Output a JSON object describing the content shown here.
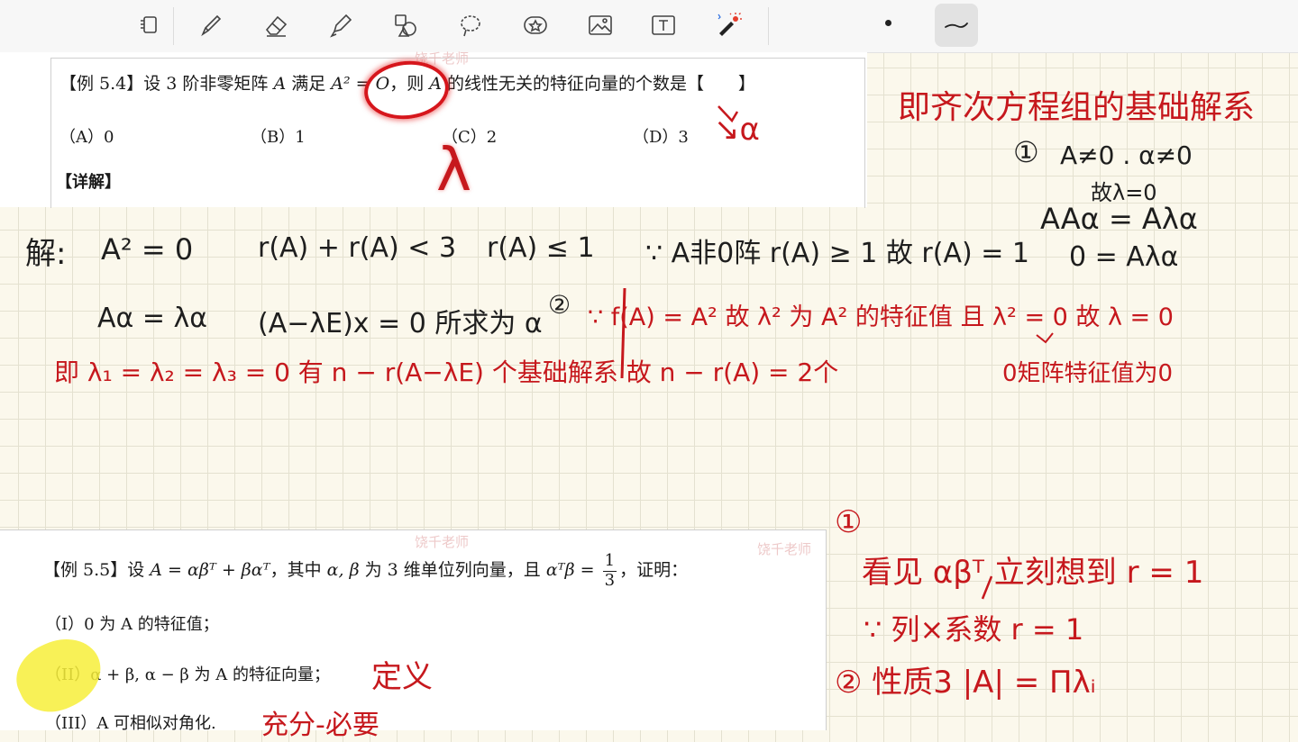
{
  "toolbar": {
    "tools": [
      "lasso-select-icon",
      "pen-icon",
      "eraser-icon",
      "highlighter-icon",
      "shapes-icon",
      "lasso-icon",
      "sticker-icon",
      "image-icon",
      "text-box-icon",
      "laser-pointer-icon"
    ],
    "pen_color": "#222222"
  },
  "example_54": {
    "title": "【例 5.4】设 3 阶非零矩阵 A 满足 A² = O，则 A 的线性无关的特征向量的个数是【　　】",
    "t_prefix": "【例 5.4】设 3 阶非零矩阵 ",
    "t_a": "A",
    "t_mid": " 满足 ",
    "t_eq": "A² = O",
    "t_mid2": "，则 ",
    "t_a2": "A",
    "t_suffix": " 的线性无关的特征向量的个数是【　　】",
    "options": [
      "（A）0",
      "（B）1",
      "（C）2",
      "（D）3"
    ],
    "detail_label": "【详解】"
  },
  "example_55": {
    "t_prefix": "【例 5.5】设 ",
    "t_formula": "A = αβᵀ + βαᵀ",
    "t_mid": "，其中 ",
    "t_vecs": "α, β",
    "t_mid2": " 为 3 维单位列向量，且 ",
    "t_cond": "αᵀβ = ",
    "frac_num": "1",
    "frac_den": "3",
    "t_suffix": "，证明：",
    "part1": "（I）0 为 A 的特征值；",
    "part2": "（II）α + β, α − β 为 A 的特征向量；",
    "part3": "（III）A 可相似对角化."
  },
  "watermark": "饶千老师",
  "handwriting": {
    "black": {
      "jie": "解:",
      "a2": "A² = 0",
      "rank_sum": "r(A) + r(A) < 3",
      "rank_le": "r(A) ≤ 1",
      "nonzero": "∵ A非0阵 r(A) ≥ 1  故 r(A) = 1",
      "eig": "Aα = λα",
      "homog": "(A−λE)x = 0  所求为 α",
      "circle2": "②",
      "c1": "①",
      "r1": "A≠0 . α≠0",
      "r2": "故λ=0",
      "r3": "AAα = Aλα",
      "r4": "0 = Aλα"
    },
    "red": {
      "lambda_mark": "λ",
      "d3_arrow": "↘α",
      "basis": "即齐次方程组的基础解系",
      "f_line": "∵ f(A) = A²   故 λ² 为 A² 的特征值  且 λ² = 0  故 λ = 0",
      "zero_note": "0矩阵特征值为0",
      "lambdas": "即 λ₁ = λ₂ = λ₃ = 0    有  n − r(A−λE) 个基础解系  故 n − r(A) = 2个",
      "c1": "①",
      "see": "看见 αβᵀ 立刻想到 r = 1",
      "rank1": "∵ 列×系数  r = 1",
      "prop3": "② 性质3   |A| = Πλᵢ",
      "def": "定义",
      "suff": "充分-必要"
    }
  }
}
